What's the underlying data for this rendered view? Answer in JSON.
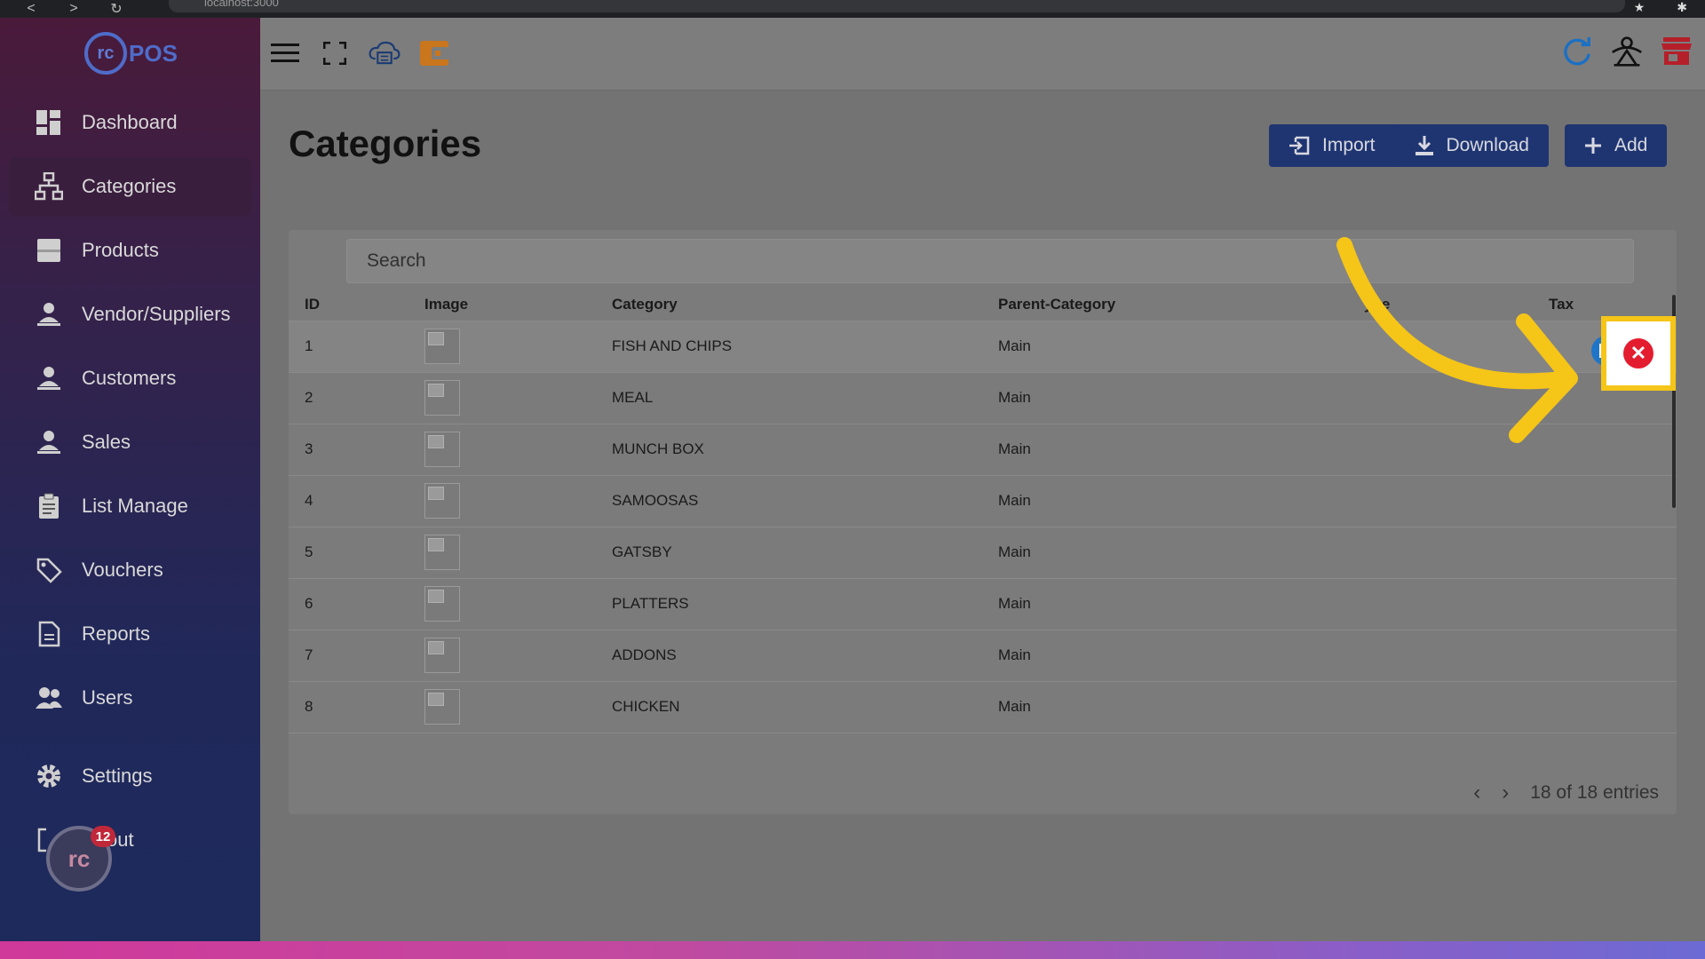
{
  "browser": {
    "url": "localhost:3000",
    "nav_back": "<",
    "nav_forward": ">",
    "nav_reload": "↻"
  },
  "brand": {
    "logo_mark": "rc",
    "logo_text": "POS"
  },
  "sidebar": {
    "items": [
      {
        "label": "Dashboard",
        "icon": "dashboard-icon"
      },
      {
        "label": "Categories",
        "icon": "hierarchy-icon",
        "active": true
      },
      {
        "label": "Products",
        "icon": "box-icon"
      },
      {
        "label": "Vendor/Suppliers",
        "icon": "person-icon"
      },
      {
        "label": "Customers",
        "icon": "person-icon"
      },
      {
        "label": "Sales",
        "icon": "person-icon"
      },
      {
        "label": "List Manage",
        "icon": "clipboard-icon"
      },
      {
        "label": "Vouchers",
        "icon": "tag-icon"
      },
      {
        "label": "Reports",
        "icon": "document-icon"
      },
      {
        "label": "Users",
        "icon": "users-icon"
      },
      {
        "label": "Settings",
        "icon": "gear-icon"
      },
      {
        "label": "Logout",
        "icon": "logout-icon"
      }
    ],
    "logout_visible_label": "out",
    "chat_badge_count": "12",
    "chat_logo_mark": "rc"
  },
  "page": {
    "title": "Categories",
    "buttons": {
      "import": "Import",
      "download": "Download",
      "add": "Add"
    },
    "search_placeholder": "Search"
  },
  "table": {
    "columns": [
      "ID",
      "Image",
      "Category",
      "Parent-Category",
      "Type",
      "Tax"
    ],
    "rows": [
      {
        "id": "1",
        "category": "FISH AND CHIPS",
        "parent": "Main"
      },
      {
        "id": "2",
        "category": "MEAL",
        "parent": "Main"
      },
      {
        "id": "3",
        "category": "MUNCH BOX",
        "parent": "Main"
      },
      {
        "id": "4",
        "category": "SAMOOSAS",
        "parent": "Main"
      },
      {
        "id": "5",
        "category": "GATSBY",
        "parent": "Main"
      },
      {
        "id": "6",
        "category": "PLATTERS",
        "parent": "Main"
      },
      {
        "id": "7",
        "category": "ADDONS",
        "parent": "Main"
      },
      {
        "id": "8",
        "category": "CHICKEN",
        "parent": "Main"
      }
    ],
    "visible_type_header": "ype"
  },
  "pagination": {
    "prev": "‹",
    "next": "›",
    "summary": "18 of 18 entries"
  },
  "colors": {
    "primary_button": "#1f3572",
    "delete": "#e41c2f",
    "edit": "#1f75c7",
    "highlight": "#f5c518"
  }
}
